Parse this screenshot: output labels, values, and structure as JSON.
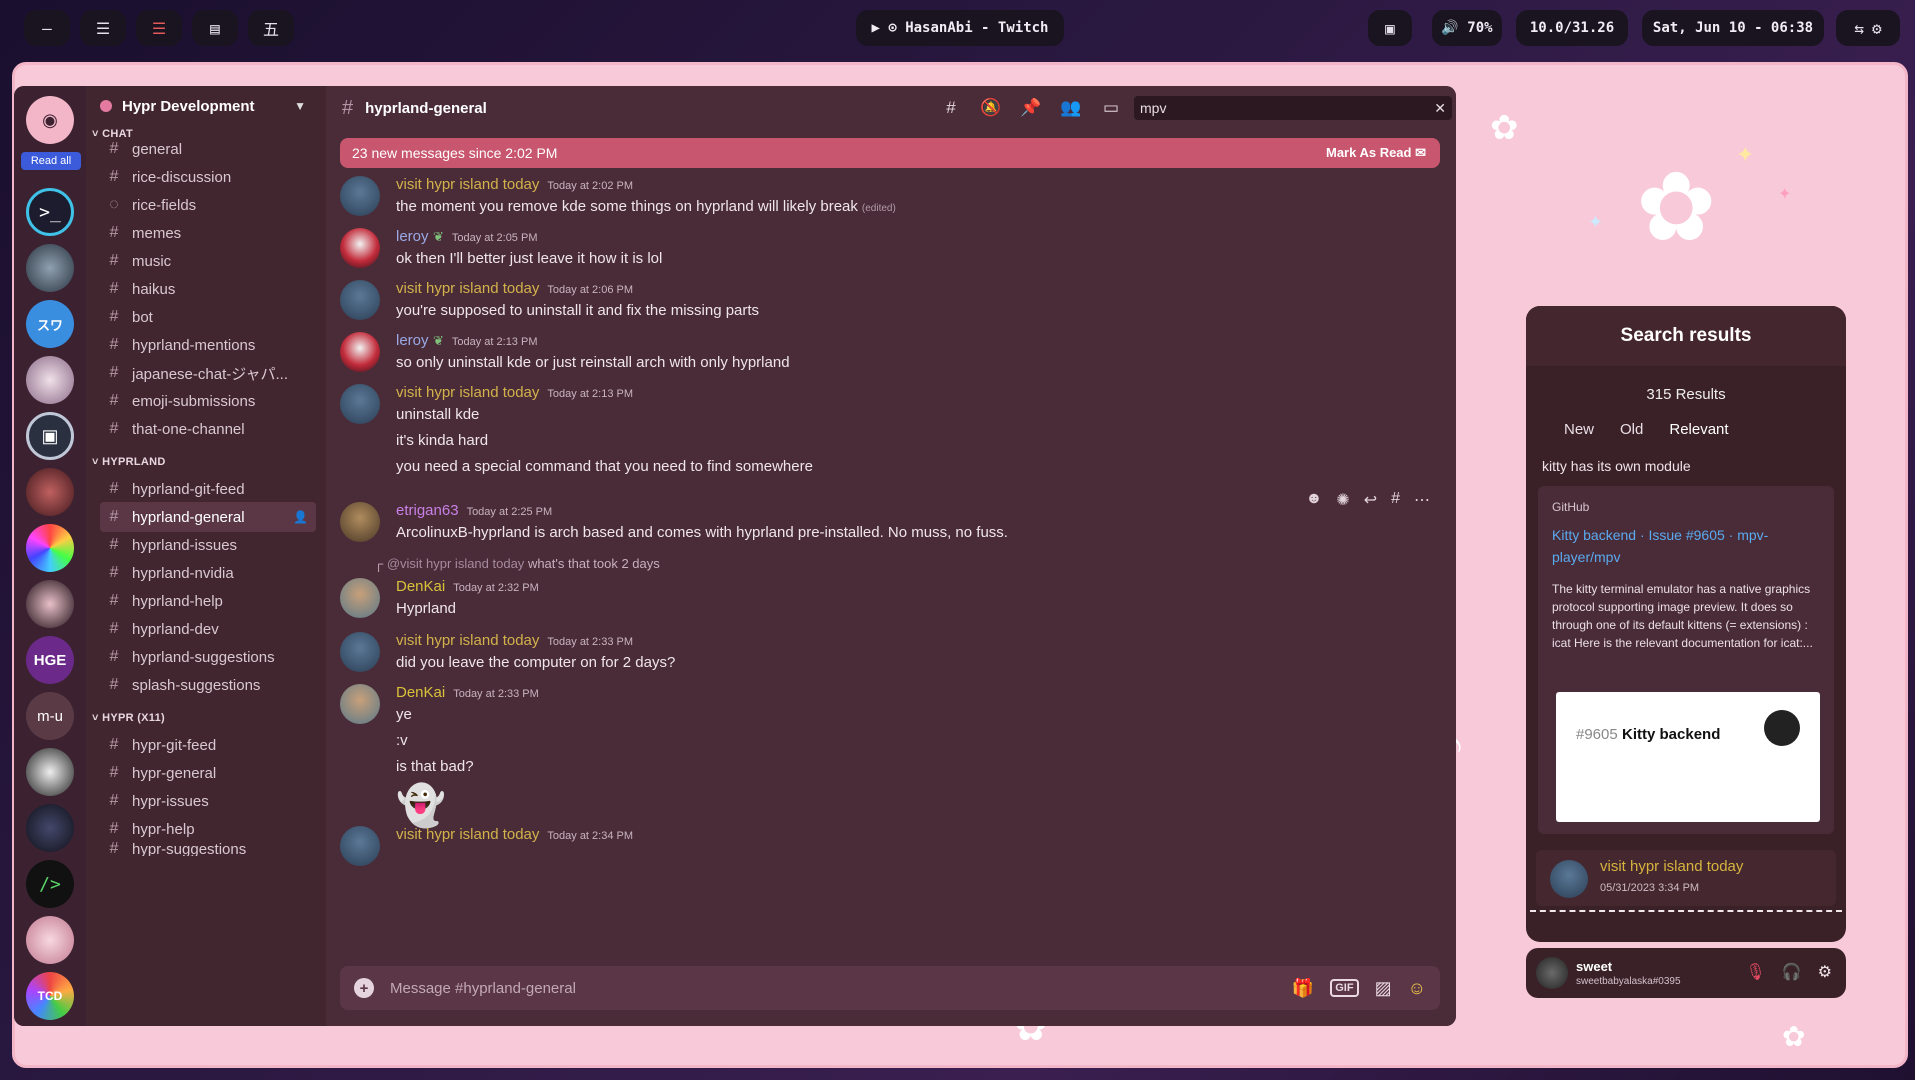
{
  "topbar": {
    "workspace_buttons": [
      "—",
      "☰",
      "☰",
      "▤",
      "五"
    ],
    "now_playing": "▶  ⊙ HasanAbi - Twitch",
    "tray_icon": "▣",
    "volume": "🔊 70%",
    "memory": "10.0/31.26",
    "datetime": "Sat, Jun 10 - 06:38",
    "right_icons": [
      "⇆",
      "⚙"
    ]
  },
  "servers": {
    "read_all": "Read all",
    "icons": [
      "discord-logo",
      "terminal",
      "eye-server",
      "su-server",
      "anime-girl",
      "book-server",
      "portrait-server",
      "color-wheel",
      "dark-girl",
      "hge-server",
      "m-u",
      "mask-server",
      "dark-server",
      "hyprland-server",
      "pink-hair",
      "tcd-server"
    ],
    "m_u_label": "m-u",
    "hge_label": "HGE",
    "su_label": "スワ",
    "tcd_label": "TCD"
  },
  "guild": {
    "name": "Hypr Development",
    "categories": [
      {
        "name": "CHAT",
        "channels": [
          "general",
          "rice-discussion",
          "rice-fields",
          "memes",
          "music",
          "haikus",
          "bot",
          "hyprland-mentions",
          "japanese-chat-ジャパ...",
          "emoji-submissions",
          "that-one-channel"
        ]
      },
      {
        "name": "HYPRLAND",
        "channels": [
          "hyprland-git-feed",
          "hyprland-general",
          "hyprland-issues",
          "hyprland-nvidia",
          "hyprland-help",
          "hyprland-dev",
          "hyprland-suggestions",
          "splash-suggestions"
        ]
      },
      {
        "name": "HYPR (X11)",
        "channels": [
          "hypr-git-feed",
          "hypr-general",
          "hypr-issues",
          "hypr-help",
          "hypr-suggestions"
        ]
      }
    ]
  },
  "chat": {
    "channel": "hyprland-general",
    "search_value": "mpv",
    "new_messages": "23 new messages since 2:02 PM",
    "mark_as_read": "Mark As Read",
    "messages": [
      {
        "author": "visit hypr island today",
        "time": "Today at 2:02 PM",
        "lines": [
          "the moment you remove kde some things on hyprland will likely break"
        ],
        "edited": "(edited)"
      },
      {
        "author": "leroy",
        "time": "Today at 2:05 PM",
        "lines": [
          "ok then I'll better just leave it how it is lol"
        ]
      },
      {
        "author": "visit hypr island today",
        "time": "Today at 2:06 PM",
        "lines": [
          "you're supposed to uninstall it and fix the missing parts"
        ]
      },
      {
        "author": "leroy",
        "time": "Today at 2:13 PM",
        "lines": [
          "so only uninstall kde or just reinstall arch with only hyprland"
        ]
      },
      {
        "author": "visit hypr island today",
        "time": "Today at 2:13 PM",
        "lines": [
          "uninstall kde",
          "it's kinda hard",
          "you need a special command that you need to find somewhere"
        ]
      },
      {
        "author": "etrigan63",
        "time": "Today at 2:25 PM",
        "lines": [
          "ArcolinuxB-hyprland is arch based and comes with hyprland pre-installed. No muss, no fuss."
        ]
      },
      {
        "author": "DenKai",
        "time": "Today at 2:32 PM",
        "reply": {
          "name": "@visit hypr island today",
          "text": "what's that took 2 days"
        },
        "lines": [
          "Hyprland"
        ]
      },
      {
        "author": "visit hypr island today",
        "time": "Today at 2:33 PM",
        "lines": [
          "did you leave the computer on for 2 days?"
        ]
      },
      {
        "author": "DenKai",
        "time": "Today at 2:33 PM",
        "lines": [
          "ye",
          ":v",
          "is that bad?"
        ]
      },
      {
        "author": "visit hypr island today",
        "time": "Today at 2:34 PM",
        "lines": []
      }
    ],
    "composer_placeholder": "Message #hyprland-general"
  },
  "search_results": {
    "title": "Search results",
    "count": "315 Results",
    "tabs": [
      "New",
      "Old",
      "Relevant"
    ],
    "snippet": "kitty has its own module",
    "embed": {
      "provider": "GitHub",
      "title": "Kitty backend · Issue #9605 · mpv-player/mpv",
      "description": "The kitty terminal emulator has a native graphics protocol supporting image preview. It does so through one of its default kittens (= extensions) : icat Here is the relevant documentation for icat:...",
      "image_num": "#9605",
      "image_title": "Kitty backend"
    },
    "author": "visit hypr island today",
    "date": "05/31/2023 3:34 PM"
  },
  "user": {
    "name": "sweet",
    "tag": "sweetbabyalaska#0395"
  }
}
